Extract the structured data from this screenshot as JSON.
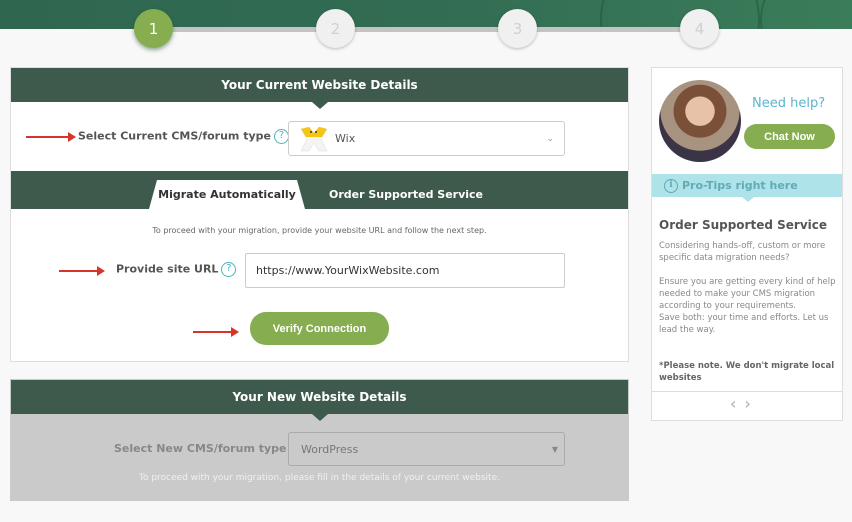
{
  "stepper": {
    "steps": [
      "1",
      "2",
      "3",
      "4"
    ],
    "active_step": 1
  },
  "current_website": {
    "title": "Your Current Website Details",
    "cms_label": "Select Current CMS/forum type",
    "help_icon": "?",
    "cms_selected": "Wix",
    "tabs": [
      {
        "label": "Migrate Automatically",
        "active": true
      },
      {
        "label": "Order Supported Service",
        "active": false
      }
    ],
    "hint": "To proceed with your migration, provide your website URL and follow the next step.",
    "url_label": "Provide site URL",
    "url_value": "https://www.YourWixWebsite.com",
    "verify_button": "Verify Connection"
  },
  "new_website": {
    "title": "Your New Website Details",
    "cms_label": "Select New CMS/forum type",
    "cms_selected": "WordPress",
    "hint": "To proceed with your migration, please fill in the details of your current website."
  },
  "sidebar": {
    "need_help": "Need help?",
    "chat_button": "Chat Now",
    "protips_label": "Pro-Tips right here",
    "tip_title": "Order Supported Service",
    "tip_para1": "Considering hands-off, custom or more specific data migration needs?",
    "tip_para2": "Ensure you are getting every kind of help needed to make your CMS migration according to your requirements.",
    "tip_para3": "Save both: your time and efforts. Let us lead the way.",
    "tip_note": "*Please note. We don't migrate local websites",
    "prev": "‹",
    "next": "›"
  },
  "colors": {
    "header_green": "#3d5a4c",
    "accent_green": "#87ad51",
    "help_blue": "#5ab6cf",
    "protips_bg": "#ade3e9",
    "arrow_red": "#d9342b"
  }
}
